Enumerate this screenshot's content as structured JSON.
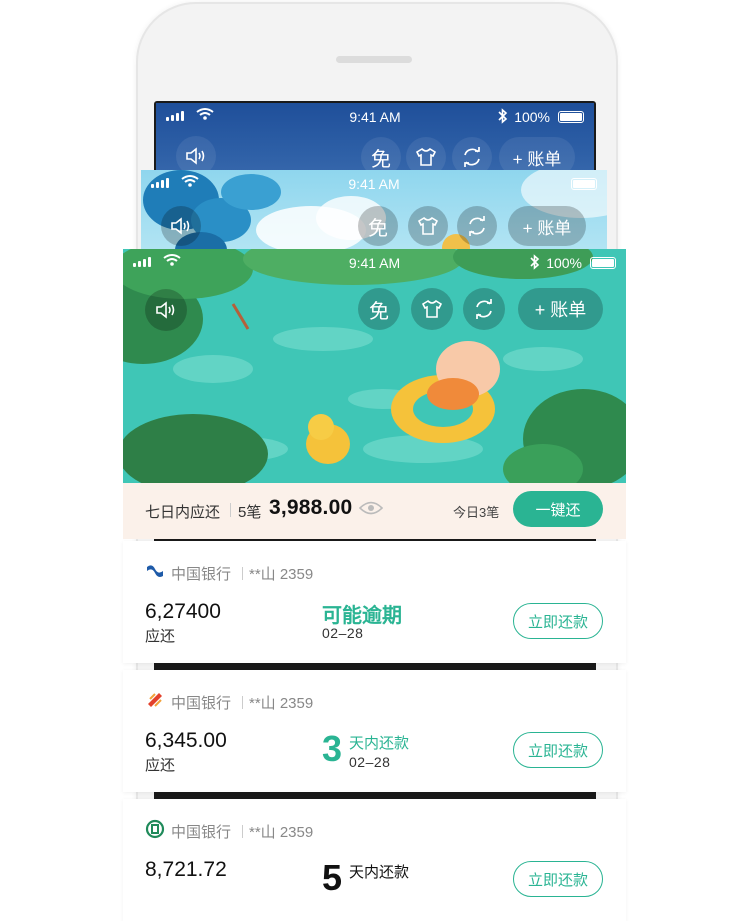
{
  "status_bar": {
    "time": "9:41 AM",
    "battery": "100%"
  },
  "toolbar": {
    "free_label": "免",
    "bill_label": "+ 账单"
  },
  "summary": {
    "label": "七日内应还",
    "count": "5笔",
    "amount": "3,988.00",
    "today": "今日3笔",
    "pay_all_label": "一键还"
  },
  "cards": [
    {
      "bank": "中国银行",
      "account": "**山 2359",
      "amount": "6,27400",
      "due_label": "应还",
      "status": "可能逾期",
      "date": "02–28",
      "repay_label": "立即还款"
    },
    {
      "bank": "中国银行",
      "account": "**山 2359",
      "amount": "6,345.00",
      "due_label": "应还",
      "days_num": "3",
      "days_label": "天内还款",
      "date": "02–28",
      "repay_label": "立即还款"
    },
    {
      "bank": "中国银行",
      "account": "**山 2359",
      "amount": "8,721.72",
      "days_num": "5",
      "days_label": "天内还款",
      "repay_label": "立即还款"
    }
  ],
  "colors": {
    "accent": "#2ab493",
    "summary_bg": "#fbf1ea",
    "pool": "#3cc6b9"
  },
  "icons": [
    "signal-icon",
    "wifi-icon",
    "bluetooth-icon",
    "battery-icon",
    "speaker-icon",
    "shirt-icon",
    "refresh-icon",
    "eye-icon",
    "bank-logo-icon"
  ]
}
